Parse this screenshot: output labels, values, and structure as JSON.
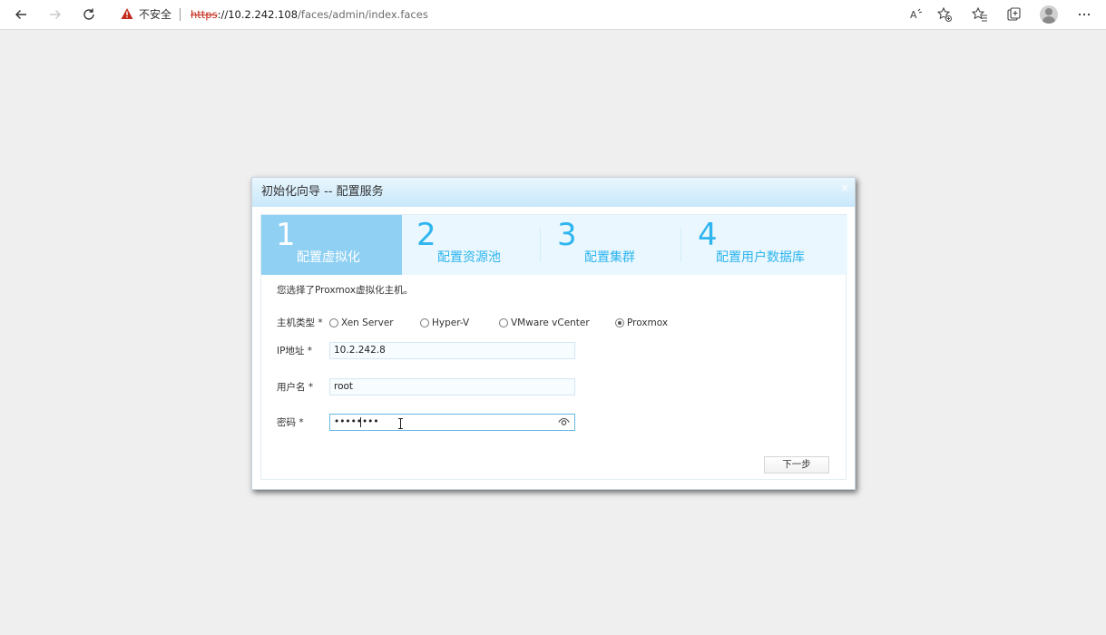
{
  "browser": {
    "security_label": "不安全",
    "url_scheme": "https",
    "url_rest": "://10.2.242.108",
    "url_path": "/faces/admin/index.faces",
    "icons": [
      "back-icon",
      "forward-icon",
      "refresh-icon",
      "warning-icon",
      "read-aloud-icon",
      "add-favorite-icon",
      "favorites-icon",
      "collections-icon",
      "profile-avatar",
      "more-icon"
    ]
  },
  "dialog": {
    "title": "初始化向导 -- 配置服务",
    "close": "×",
    "steps": [
      {
        "num": "1",
        "label": "配置虚拟化",
        "active": true
      },
      {
        "num": "2",
        "label": "配置资源池",
        "active": false
      },
      {
        "num": "3",
        "label": "配置集群",
        "active": false
      },
      {
        "num": "4",
        "label": "配置用户数据库",
        "active": false
      }
    ],
    "info_text": "您选择了Proxmox虚拟化主机。",
    "form": {
      "host_type_label": "主机类型 *",
      "host_type_options": [
        {
          "label": "Xen Server",
          "checked": false
        },
        {
          "label": "Hyper-V",
          "checked": false
        },
        {
          "label": "VMware vCenter",
          "checked": false
        },
        {
          "label": "Proxmox",
          "checked": true
        }
      ],
      "ip_label": "IP地址 *",
      "ip_value": "10.2.242.8",
      "user_label": "用户名 *",
      "user_value": "root",
      "password_label": "密码 *",
      "password_value": "••••••••"
    },
    "next_button": "下一步"
  },
  "colors": {
    "step_active_bg": "#8fd0f3",
    "step_text": "#2fb5ef",
    "header_gradient_top": "#e9f6fd",
    "header_gradient_bottom": "#c8e8fb",
    "warning_red": "#c42b1c"
  }
}
